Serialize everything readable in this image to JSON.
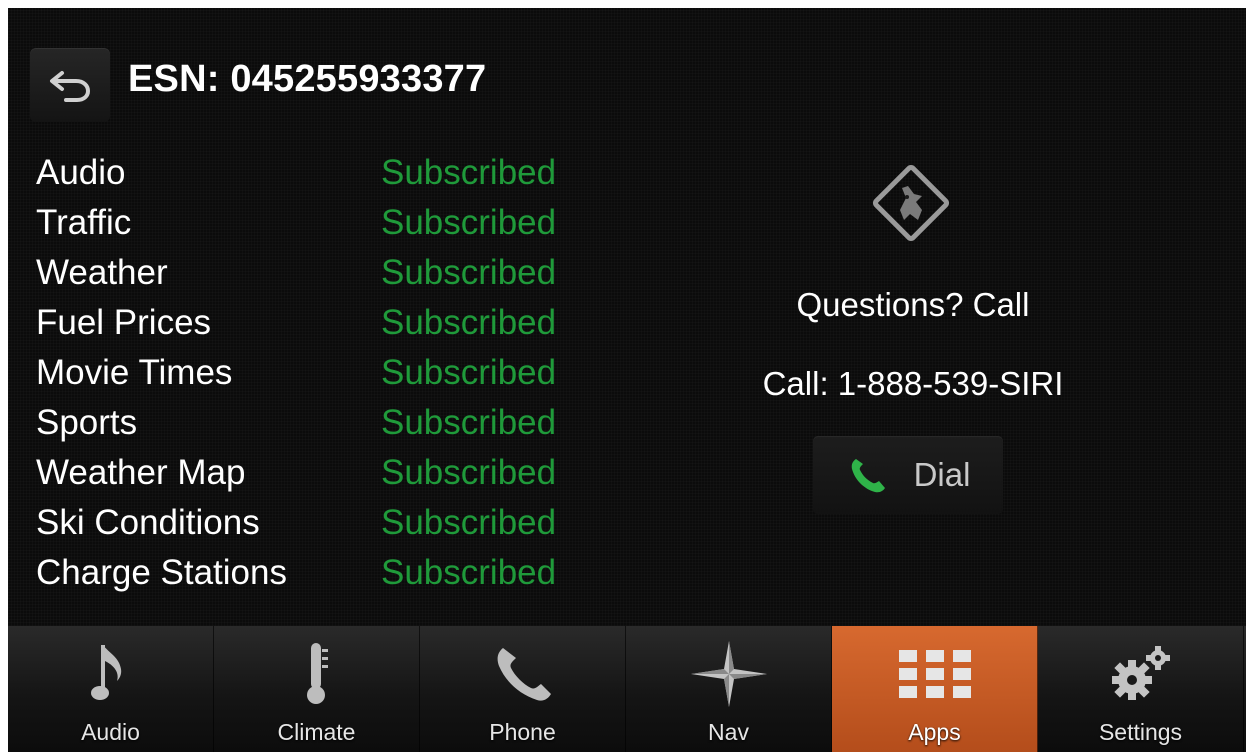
{
  "header": {
    "title": "ESN: 045255933377"
  },
  "services": [
    {
      "name": "Audio",
      "status": "Subscribed"
    },
    {
      "name": "Traffic",
      "status": "Subscribed"
    },
    {
      "name": "Weather",
      "status": "Subscribed"
    },
    {
      "name": "Fuel Prices",
      "status": "Subscribed"
    },
    {
      "name": "Movie Times",
      "status": "Subscribed"
    },
    {
      "name": "Sports",
      "status": "Subscribed"
    },
    {
      "name": "Weather Map",
      "status": "Subscribed"
    },
    {
      "name": "Ski Conditions",
      "status": "Subscribed"
    },
    {
      "name": "Charge Stations",
      "status": "Subscribed"
    }
  ],
  "support": {
    "questions": "Questions? Call",
    "call_number": "Call: 1-888-539-SIRI",
    "dial_label": "Dial"
  },
  "nav": {
    "tabs": [
      {
        "label": "Audio",
        "icon": "music-note-icon"
      },
      {
        "label": "Climate",
        "icon": "thermometer-icon"
      },
      {
        "label": "Phone",
        "icon": "phone-handset-icon"
      },
      {
        "label": "Nav",
        "icon": "compass-star-icon"
      },
      {
        "label": "Apps",
        "icon": "apps-grid-icon",
        "active": true
      },
      {
        "label": "Settings",
        "icon": "gears-icon"
      }
    ]
  },
  "colors": {
    "subscribed": "#1f9a3a",
    "active_tab": "#c85a24",
    "background": "#0b0b0b"
  }
}
